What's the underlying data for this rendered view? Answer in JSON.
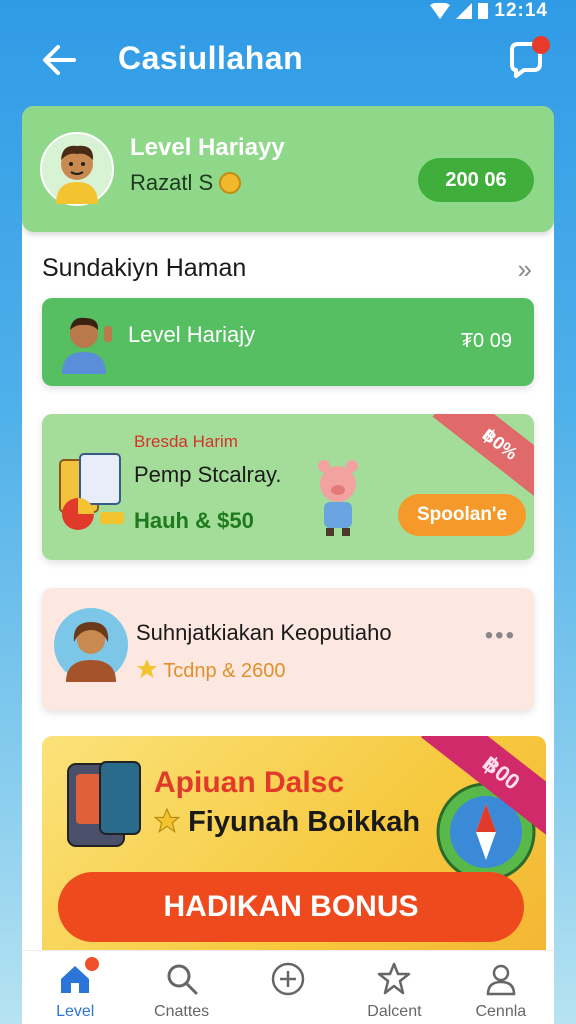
{
  "status_bar": {
    "time": "12:14"
  },
  "app_bar": {
    "title": "Casiullahan"
  },
  "hero": {
    "title": "Level Hariayy",
    "subtitle": "Razatl S",
    "pill_label": "200 06"
  },
  "section": {
    "title": "Sundakiyn Haman",
    "more_glyph": "»"
  },
  "level_card": {
    "title": "Level Hariajy",
    "value": "₮0 09"
  },
  "promo_card": {
    "eyebrow": "Bresda Harim",
    "title": "Pemp Stcalray.",
    "amount": "Hauh & $50",
    "button_label": "Spoolan'e",
    "ribbon": "฿0%"
  },
  "user_card": {
    "title": "Suhnjatkiakan Keoputiaho",
    "subtitle": "Tcdnp & 2600",
    "more_glyph": "•••"
  },
  "banner": {
    "title": "Apiuan Dalsc",
    "subtitle": "Fiyunah Boikkah",
    "button_label": "HADIKAN BONUS",
    "ribbon": "฿00"
  },
  "bottom_nav": [
    {
      "label": "Level",
      "icon": "home-icon",
      "active": true
    },
    {
      "label": "Cnattes",
      "icon": "search-icon",
      "active": false
    },
    {
      "label": "",
      "icon": "plus-circle-icon",
      "active": false
    },
    {
      "label": "Dalcent",
      "icon": "star-icon",
      "active": false
    },
    {
      "label": "Cennla",
      "icon": "profile-icon",
      "active": false
    }
  ],
  "colors": {
    "accent_blue": "#2f9be6",
    "hero_green": "#8fd88a",
    "card_green": "#55bf61",
    "promo_orange": "#f59a2a",
    "bonus_red": "#ee4a1e"
  }
}
